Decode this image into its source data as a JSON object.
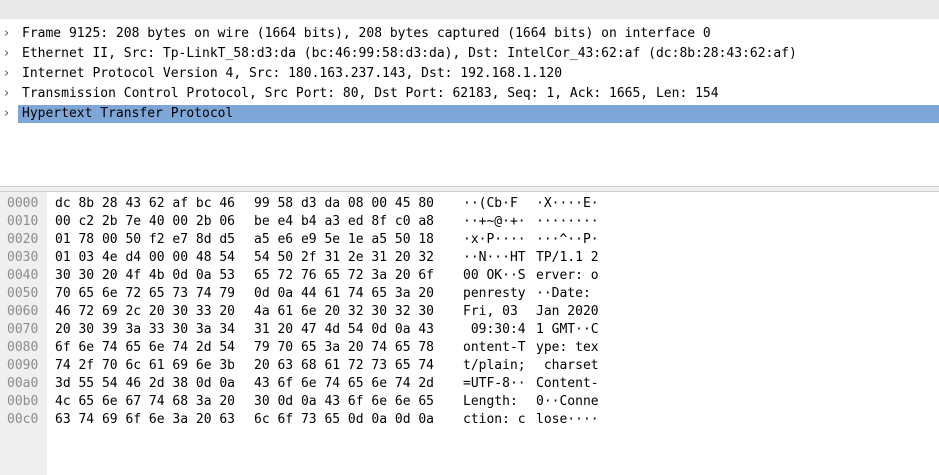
{
  "detail_tree": [
    {
      "label": "Frame 9125: 208 bytes on wire (1664 bits), 208 bytes captured (1664 bits) on interface 0",
      "selected": false
    },
    {
      "label": "Ethernet II, Src: Tp-LinkT_58:d3:da (bc:46:99:58:d3:da), Dst: IntelCor_43:62:af (dc:8b:28:43:62:af)",
      "selected": false
    },
    {
      "label": "Internet Protocol Version 4, Src: 180.163.237.143, Dst: 192.168.1.120",
      "selected": false
    },
    {
      "label": "Transmission Control Protocol, Src Port: 80, Dst Port: 62183, Seq: 1, Ack: 1665, Len: 154",
      "selected": false
    },
    {
      "label": "Hypertext Transfer Protocol",
      "selected": true
    }
  ],
  "expander_glyph": "›",
  "hex_rows": [
    {
      "offset": "0000",
      "hex1": "dc 8b 28 43 62 af bc 46",
      "hex2": "99 58 d3 da 08 00 45 80",
      "ascii1": "··(Cb·F ",
      "ascii2": "·X····E·"
    },
    {
      "offset": "0010",
      "hex1": "00 c2 2b 7e 40 00 2b 06",
      "hex2": "be e4 b4 a3 ed 8f c0 a8",
      "ascii1": "··+~@·+·",
      "ascii2": "········"
    },
    {
      "offset": "0020",
      "hex1": "01 78 00 50 f2 e7 8d d5",
      "hex2": "a5 e6 e9 5e 1e a5 50 18",
      "ascii1": "·x·P····",
      "ascii2": "···^··P·"
    },
    {
      "offset": "0030",
      "hex1": "01 03 4e d4 00 00 48 54",
      "hex2": "54 50 2f 31 2e 31 20 32",
      "ascii1": "··N···HT",
      "ascii2": "TP/1.1 2"
    },
    {
      "offset": "0040",
      "hex1": "30 30 20 4f 4b 0d 0a 53",
      "hex2": "65 72 76 65 72 3a 20 6f",
      "ascii1": "00 OK··S",
      "ascii2": "erver: o"
    },
    {
      "offset": "0050",
      "hex1": "70 65 6e 72 65 73 74 79",
      "hex2": "0d 0a 44 61 74 65 3a 20",
      "ascii1": "penresty",
      "ascii2": "··Date: "
    },
    {
      "offset": "0060",
      "hex1": "46 72 69 2c 20 30 33 20",
      "hex2": "4a 61 6e 20 32 30 32 30",
      "ascii1": "Fri, 03 ",
      "ascii2": "Jan 2020"
    },
    {
      "offset": "0070",
      "hex1": "20 30 39 3a 33 30 3a 34",
      "hex2": "31 20 47 4d 54 0d 0a 43",
      "ascii1": " 09:30:4",
      "ascii2": "1 GMT··C"
    },
    {
      "offset": "0080",
      "hex1": "6f 6e 74 65 6e 74 2d 54",
      "hex2": "79 70 65 3a 20 74 65 78",
      "ascii1": "ontent-T",
      "ascii2": "ype: tex"
    },
    {
      "offset": "0090",
      "hex1": "74 2f 70 6c 61 69 6e 3b",
      "hex2": "20 63 68 61 72 73 65 74",
      "ascii1": "t/plain;",
      "ascii2": " charset"
    },
    {
      "offset": "00a0",
      "hex1": "3d 55 54 46 2d 38 0d 0a",
      "hex2": "43 6f 6e 74 65 6e 74 2d",
      "ascii1": "=UTF-8··",
      "ascii2": "Content-"
    },
    {
      "offset": "00b0",
      "hex1": "4c 65 6e 67 74 68 3a 20",
      "hex2": "30 0d 0a 43 6f 6e 6e 65",
      "ascii1": "Length: ",
      "ascii2": "0··Conne"
    },
    {
      "offset": "00c0",
      "hex1": "63 74 69 6f 6e 3a 20 63",
      "hex2": "6c 6f 73 65 0d 0a 0d 0a",
      "ascii1": "ction: c",
      "ascii2": "lose····"
    }
  ]
}
